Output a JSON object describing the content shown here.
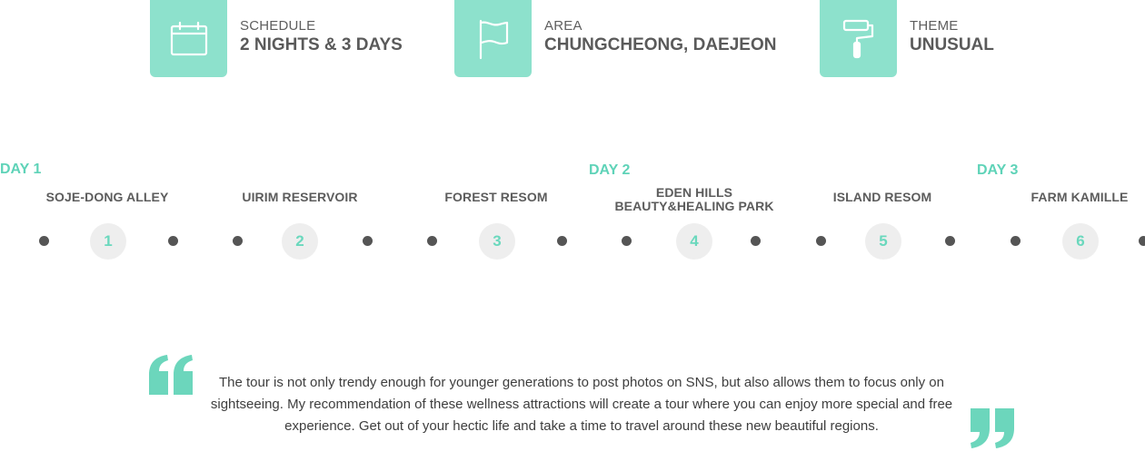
{
  "info": {
    "schedule": {
      "label": "SCHEDULE",
      "value": "2 NIGHTS & 3 DAYS",
      "icon": "calendar-icon"
    },
    "area": {
      "label": "AREA",
      "value": "CHUNGCHEONG, DAEJEON",
      "icon": "flag-icon"
    },
    "theme": {
      "label": "THEME",
      "value": "UNUSUAL",
      "icon": "paint-roller-icon"
    }
  },
  "timeline": {
    "days": [
      "DAY 1",
      "DAY 2",
      "DAY 3"
    ],
    "stops": [
      {
        "number": "1",
        "name_line1": "SOJE-DONG ALLEY",
        "name_line2": ""
      },
      {
        "number": "2",
        "name_line1": "UIRIM RESERVOIR",
        "name_line2": ""
      },
      {
        "number": "3",
        "name_line1": "FOREST RESOM",
        "name_line2": ""
      },
      {
        "number": "4",
        "name_line1": "EDEN HILLS",
        "name_line2": "BEAUTY&HEALING PARK"
      },
      {
        "number": "5",
        "name_line1": "ISLAND RESOM",
        "name_line2": ""
      },
      {
        "number": "6",
        "name_line1": "FARM KAMILLE",
        "name_line2": ""
      }
    ]
  },
  "quote": {
    "text": "The tour is not only trendy enough for younger generations to post photos on SNS, but also allows them to focus only on sightseeing. My recommendation of these wellness attractions will create a tour where you can enjoy more special and free experience. Get out of your hectic life and take a time to travel around these new beautiful regions."
  },
  "colors": {
    "accent": "#8de1cc",
    "accent_text": "#5fd3b8",
    "dot": "#555555",
    "circle": "#eeeeee"
  }
}
